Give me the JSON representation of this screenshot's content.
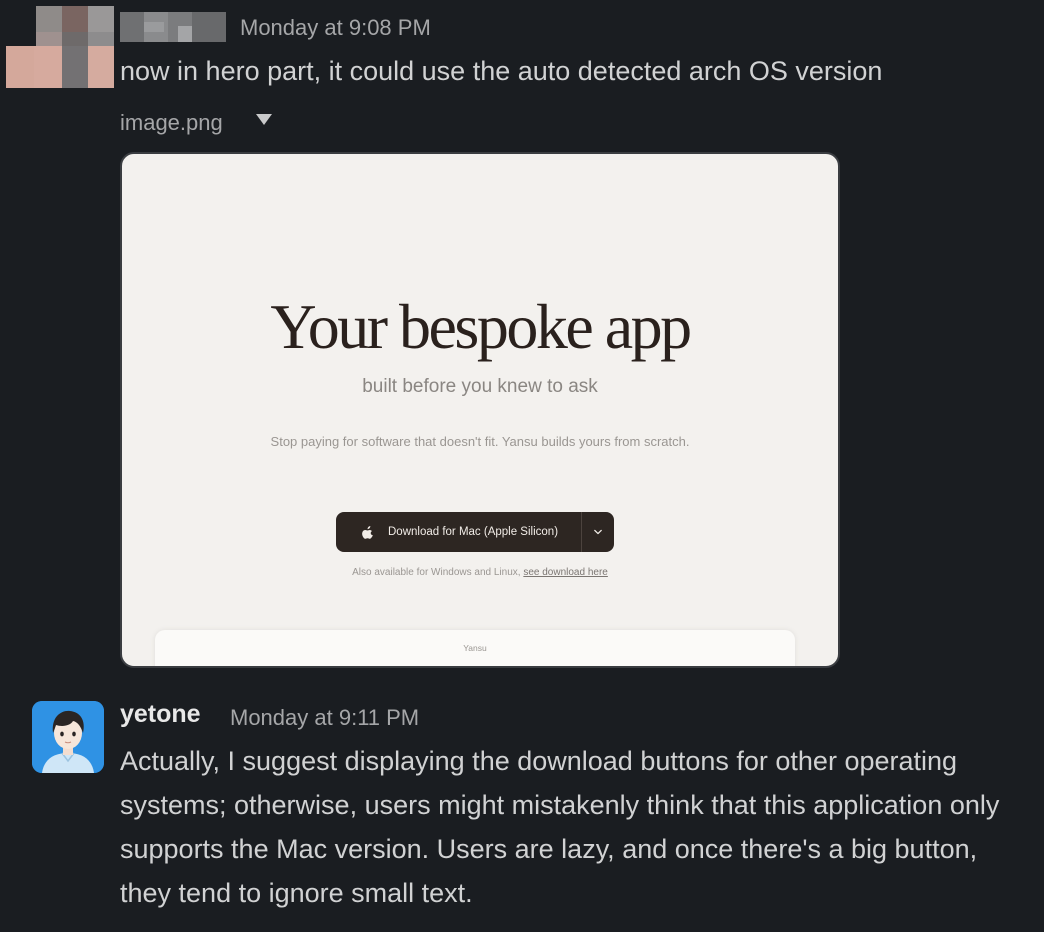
{
  "messages": [
    {
      "timestamp": "Monday at 9:08 PM",
      "text": "now in hero part, it could use the auto detected arch OS version",
      "attachment": {
        "file_name": "image.png",
        "preview": {
          "title": "Your bespoke app",
          "subtitle": "built before you knew to ask",
          "description": "Stop paying for software that doesn't fit. Yansu builds yours from scratch.",
          "download_button_label": "Download for Mac (Apple Silicon)",
          "also_available_text": "Also available for Windows and Linux,",
          "also_available_link": "see download here",
          "card_label": "Yansu"
        }
      }
    },
    {
      "author": "yetone",
      "timestamp": "Monday at 9:11 PM",
      "text": "Actually, I suggest displaying the download buttons for other operating systems; otherwise, users might mistakenly think that this application only supports the Mac version. Users are lazy, and once there's a big button, they tend to ignore small text."
    }
  ],
  "colors": {
    "background": "#1a1d21",
    "message_text": "#d1d2d3",
    "timestamp_text": "#a5a6a8",
    "preview_background": "#f3f1ee",
    "download_button": "#2d2622"
  }
}
